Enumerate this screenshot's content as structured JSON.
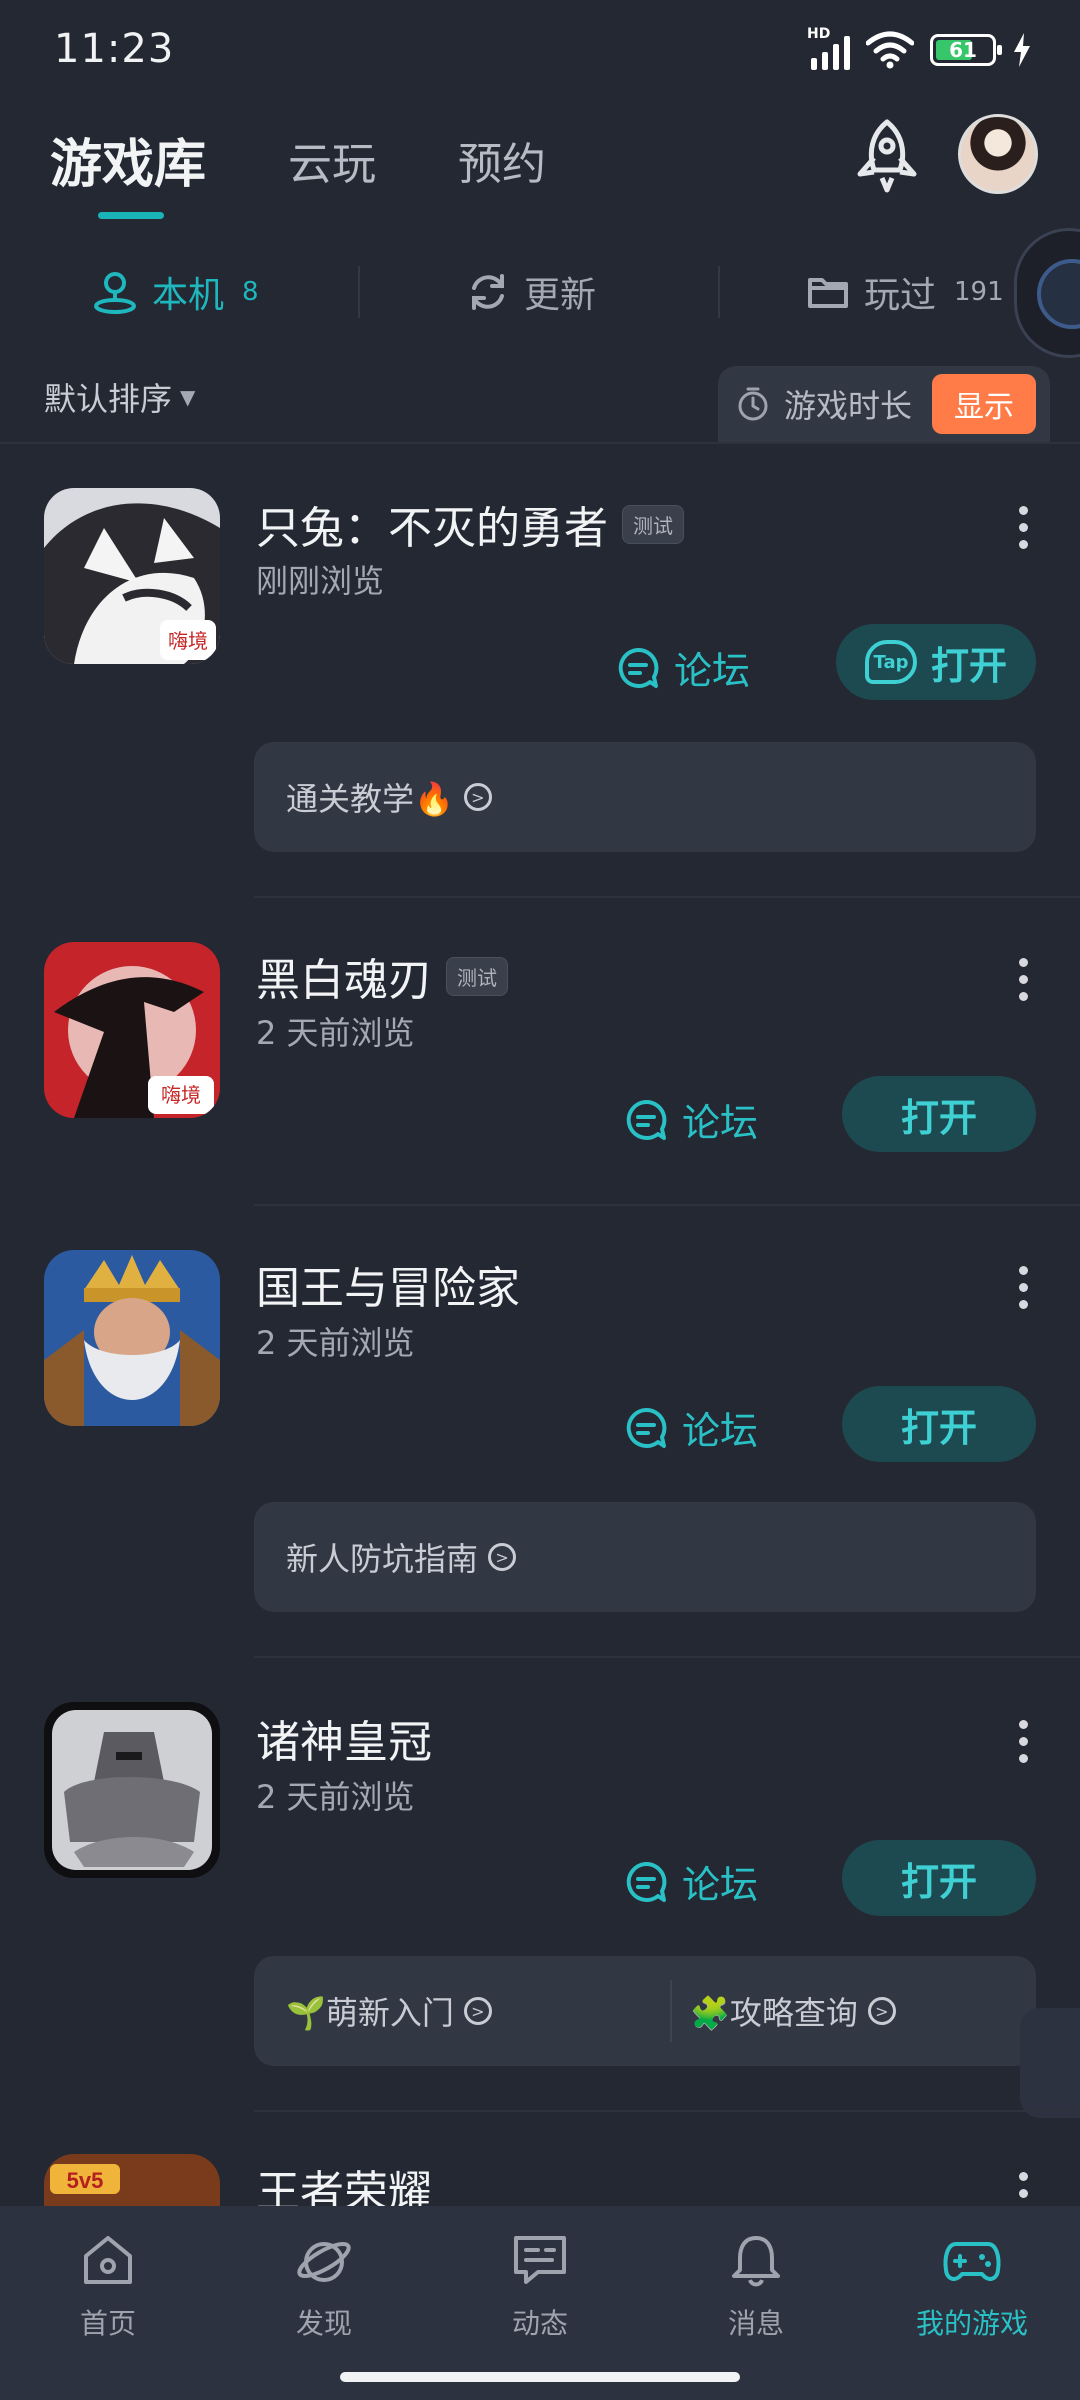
{
  "status_bar": {
    "time": "11:23",
    "signal_label": "HD",
    "battery": "61"
  },
  "header": {
    "tabs": [
      {
        "label": "游戏库",
        "active": true
      },
      {
        "label": "云玩",
        "active": false
      },
      {
        "label": "预约",
        "active": false
      }
    ]
  },
  "segments": {
    "local": {
      "label": "本机",
      "count": "8"
    },
    "update": {
      "label": "更新"
    },
    "played": {
      "label": "玩过",
      "count": "191"
    }
  },
  "sort": {
    "label": "默认排序"
  },
  "playtime": {
    "label": "游戏时长",
    "button": "显示"
  },
  "common": {
    "forum_label": "论坛",
    "open_label": "打开",
    "tap_logo": "Tap"
  },
  "games": [
    {
      "title": "只兔：不灭的勇者",
      "badge": "测试",
      "subtitle": "刚刚浏览",
      "tips": [
        "通关教学🔥"
      ]
    },
    {
      "title": "黑白魂刃",
      "badge": "测试",
      "subtitle": "2 天前浏览",
      "tips": []
    },
    {
      "title": "国王与冒险家",
      "badge": "",
      "subtitle": "2 天前浏览",
      "tips": [
        "新人防坑指南"
      ]
    },
    {
      "title": "诸神皇冠",
      "badge": "",
      "subtitle": "2 天前浏览",
      "tips": [
        "🌱萌新入门",
        "🧩攻略查询"
      ]
    },
    {
      "title": "王者荣耀",
      "badge": "",
      "subtitle": "",
      "tips": []
    }
  ],
  "bottom_nav": [
    {
      "label": "首页",
      "icon": "home-icon"
    },
    {
      "label": "发现",
      "icon": "discover-icon"
    },
    {
      "label": "动态",
      "icon": "feed-icon"
    },
    {
      "label": "消息",
      "icon": "bell-icon"
    },
    {
      "label": "我的游戏",
      "icon": "gamepad-icon",
      "active": true
    }
  ],
  "colors": {
    "accent": "#29c1c6",
    "orange": "#ff7b47",
    "background": "#242833"
  }
}
